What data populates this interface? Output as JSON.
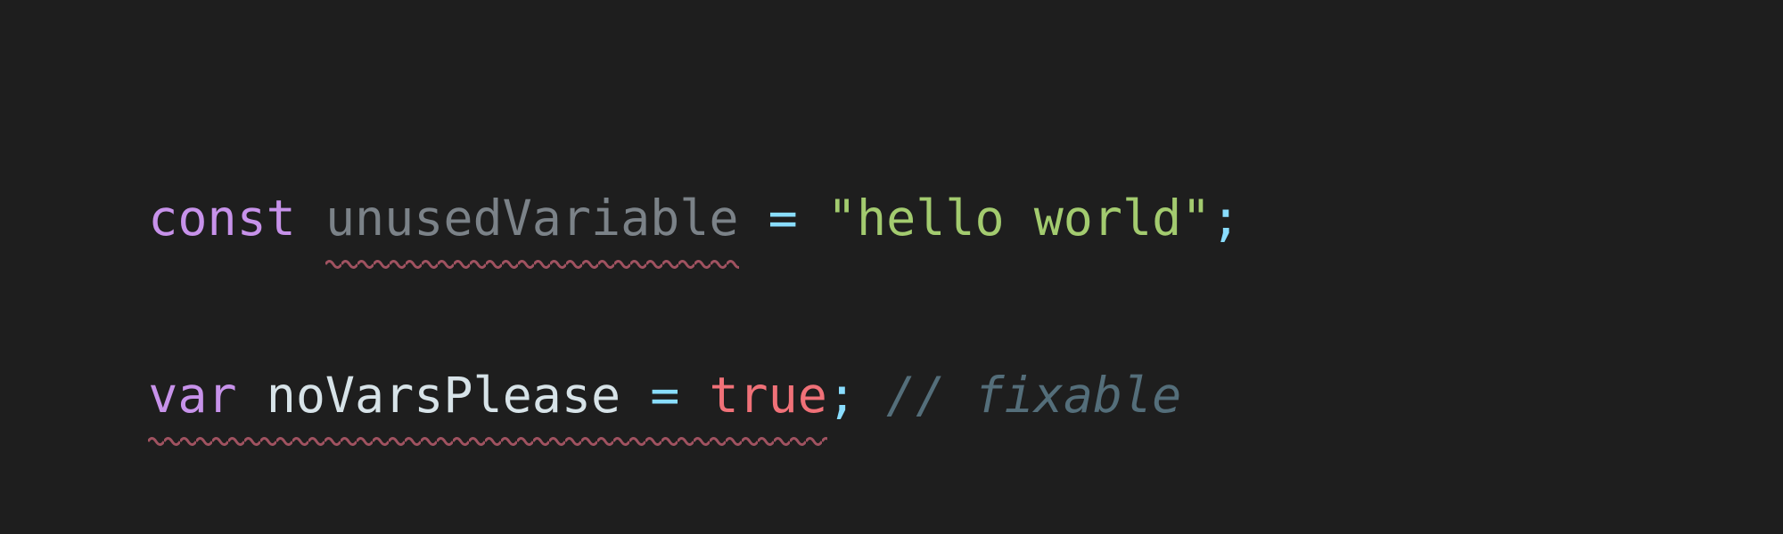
{
  "line1": {
    "keyword": "const",
    "space1": " ",
    "identifier": "unusedVariable",
    "space2": " ",
    "operator": "=",
    "space3": " ",
    "string": "\"hello world\"",
    "semicolon": ";"
  },
  "line2": {
    "keyword": "var",
    "space1": " ",
    "identifier": "noVarsPlease",
    "space2": " ",
    "operator": "=",
    "space3": " ",
    "bool": "true",
    "semicolon": ";",
    "space4": " ",
    "comment": "// fixable"
  }
}
